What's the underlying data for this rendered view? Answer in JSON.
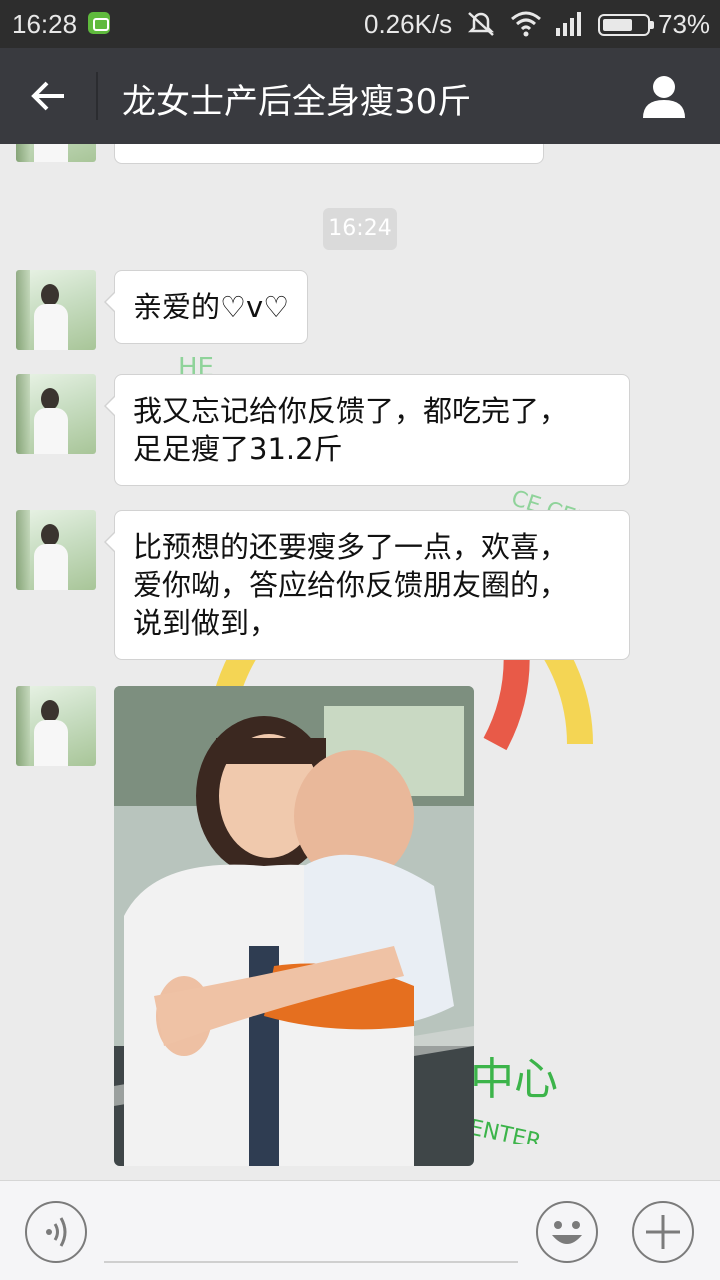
{
  "status_bar": {
    "time": "16:28",
    "net_speed": "0.26K/s",
    "battery_percent": "73%",
    "battery_level": 0.73,
    "icons": [
      "app-notification-icon",
      "mute-icon",
      "wifi-icon",
      "signal-icon",
      "battery-icon"
    ]
  },
  "header": {
    "title": "龙女士产后全身瘦30斤",
    "icons": [
      "back-arrow-icon",
      "profile-icon"
    ]
  },
  "chat": {
    "time_badge": "16:24",
    "messages": [
      {
        "lines": [
          "亲爱的♡v♡"
        ]
      },
      {
        "lines": [
          "我又忘记给你反馈了，都吃完了，",
          "足足瘦了31.2斤"
        ]
      },
      {
        "lines": [
          "比预想的还要瘦多了一点，欢喜，",
          "爱你呦，答应给你反馈朋友圈的，",
          "说到做到，"
        ]
      }
    ],
    "watermark": {
      "text_top": "HE",
      "text_right": "CE CENTE",
      "text_bottom_cn": "中心",
      "text_bottom_en": "ENTER"
    }
  },
  "input_bar": {
    "placeholder": "",
    "icons": [
      "voice-icon",
      "emoji-icon",
      "plus-icon"
    ]
  },
  "colors": {
    "status_bar_bg": "#2d2d2d",
    "title_bar_bg": "#393a3f",
    "chat_bg": "#ebebeb",
    "bubble_bg": "#ffffff",
    "watermark_green": "#3cb44a"
  }
}
